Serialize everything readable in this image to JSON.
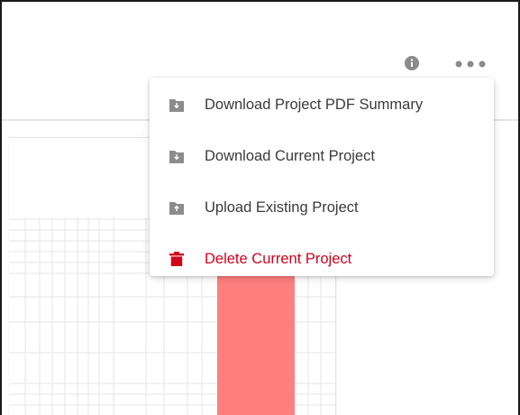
{
  "header": {
    "icons": {
      "info": "info-circle-icon",
      "more": "more-horizontal-icon"
    }
  },
  "menu": {
    "items": [
      {
        "label": "Download Project PDF Summary",
        "icon": "download-icon",
        "danger": false
      },
      {
        "label": "Download Current Project",
        "icon": "download-icon",
        "danger": false
      },
      {
        "label": "Upload Existing Project",
        "icon": "upload-icon",
        "danger": false
      },
      {
        "label": "Delete Current Project",
        "icon": "trash-icon",
        "danger": true
      }
    ]
  },
  "colors": {
    "danger": "#d0021b",
    "icon_gray": "#8c8c8c",
    "bar_fill": "#ff7f7f",
    "grid_line": "#e6e6e6"
  }
}
